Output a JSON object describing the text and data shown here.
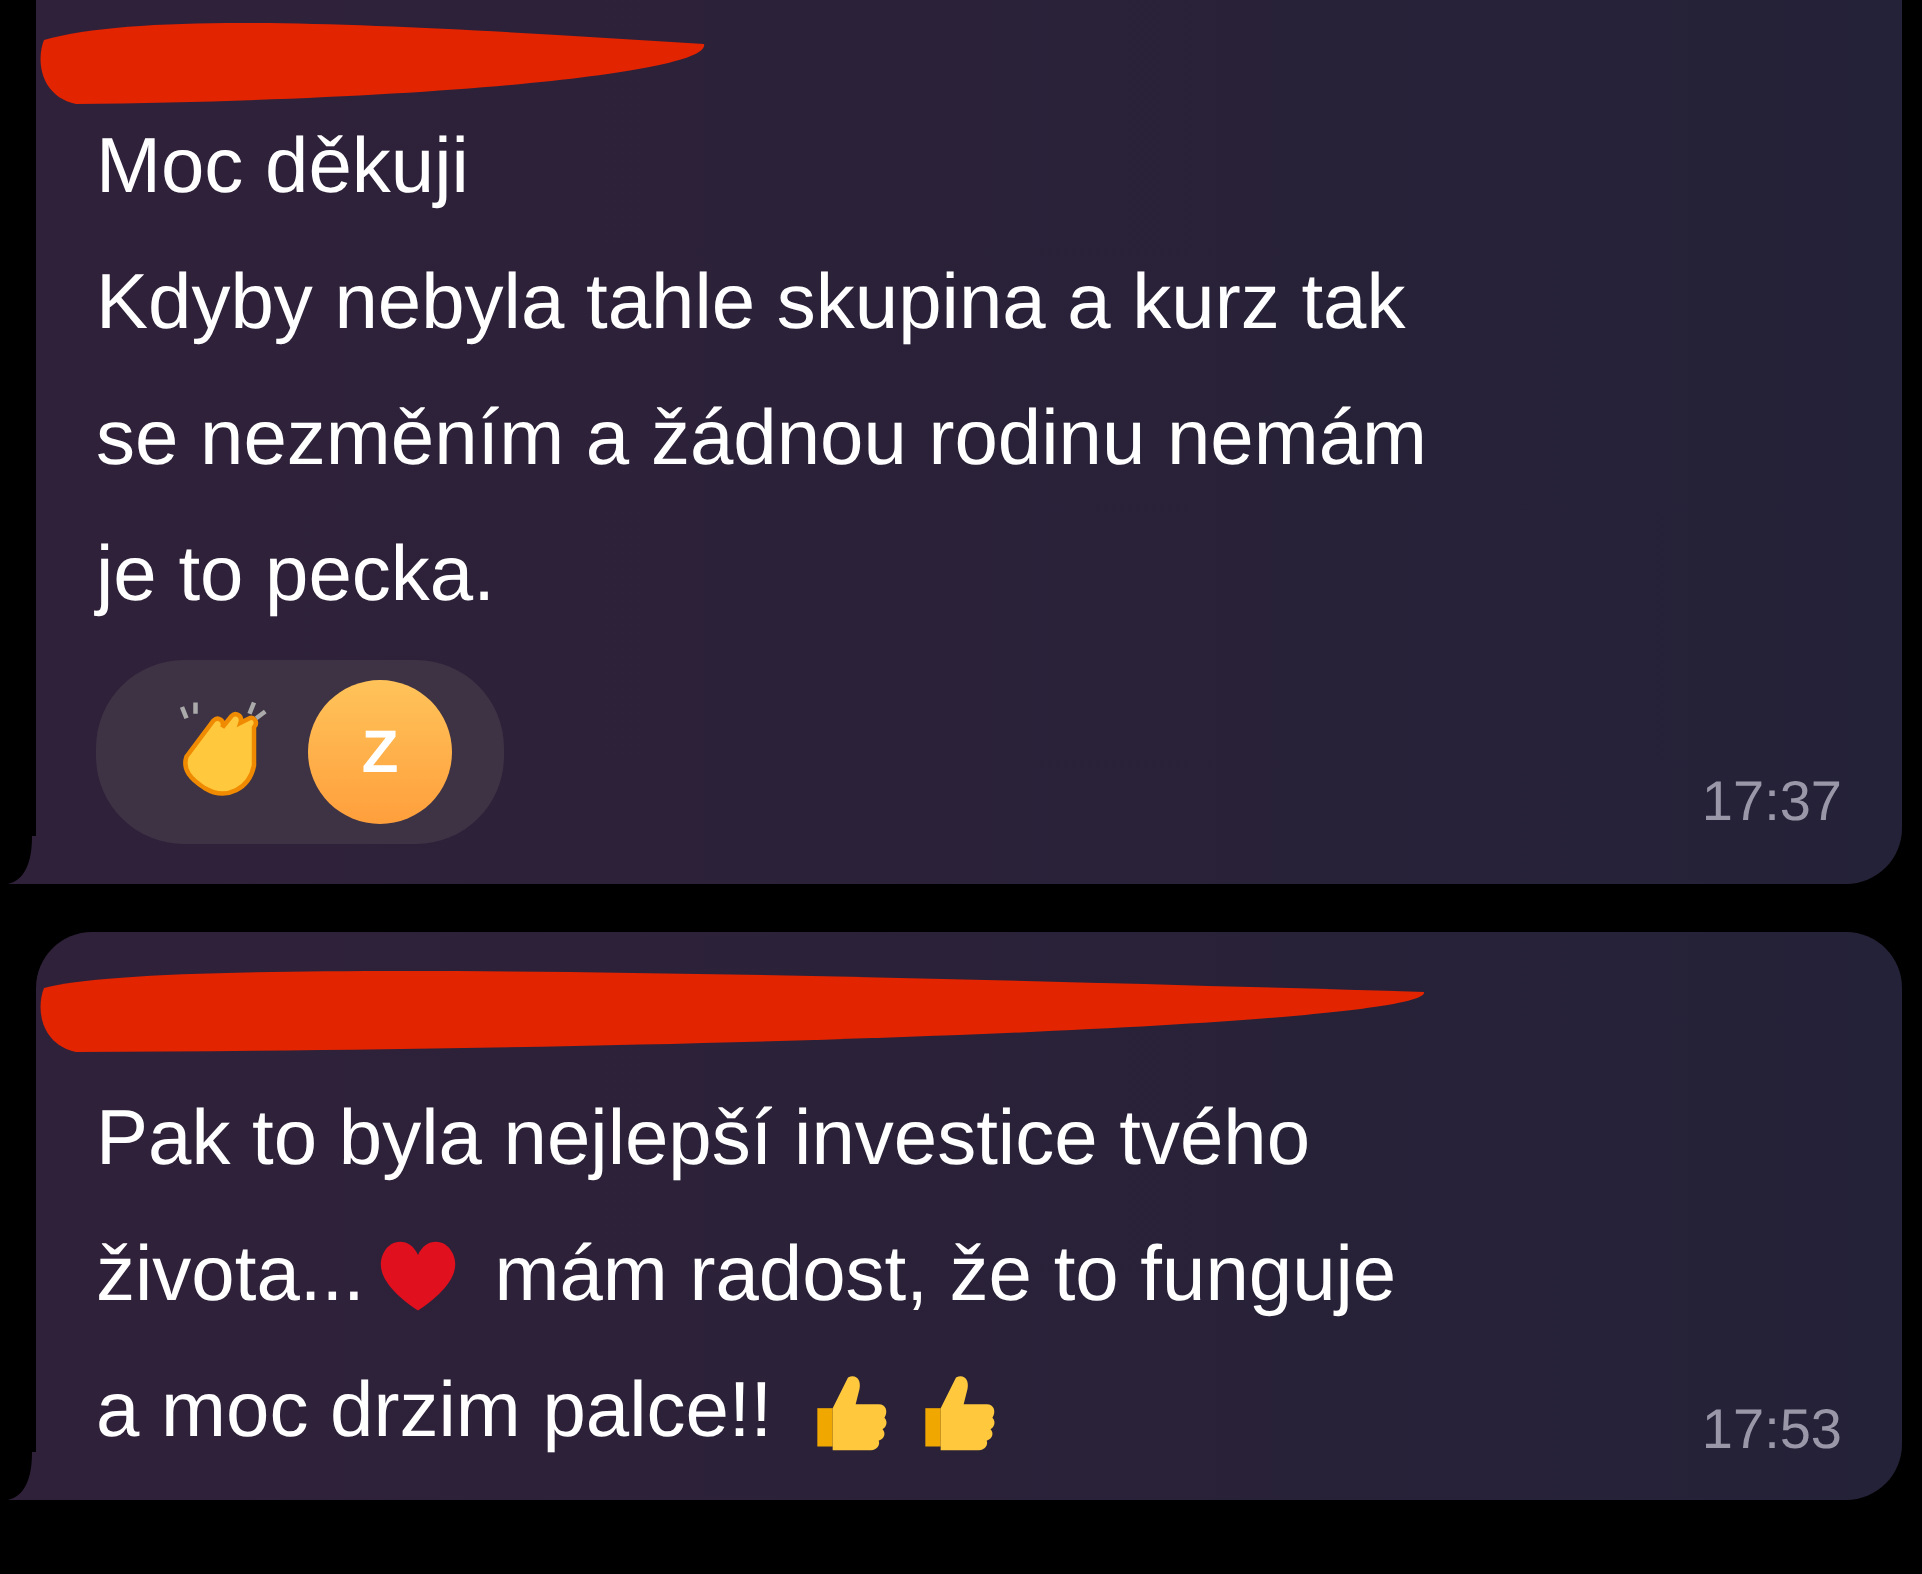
{
  "messages": [
    {
      "lines": [
        [
          {
            "kind": "text",
            "text": "Moc děkuji"
          }
        ],
        [
          {
            "kind": "text",
            "text": "Kdyby nebyla tahle skupina a kurz tak"
          }
        ],
        [
          {
            "kind": "text",
            "text": "se nezměním a žádnou rodinu nemám"
          }
        ],
        [
          {
            "kind": "text",
            "text": "je to pecka."
          }
        ]
      ],
      "reactions": [
        {
          "kind": "clap",
          "avatar": "Z"
        }
      ],
      "time": "17:37"
    },
    {
      "lines": [
        [
          {
            "kind": "text",
            "text": "Pak to byla nejlepší investice tvého"
          }
        ],
        [
          {
            "kind": "text",
            "text": "života..."
          },
          {
            "kind": "heart"
          },
          {
            "kind": "text",
            "text": " mám radost, že to funguje"
          }
        ],
        [
          {
            "kind": "text",
            "text": "a moc drzim palce!! "
          },
          {
            "kind": "thumbs-up"
          },
          {
            "kind": "thumbs-up"
          }
        ]
      ],
      "time": "17:53"
    }
  ]
}
